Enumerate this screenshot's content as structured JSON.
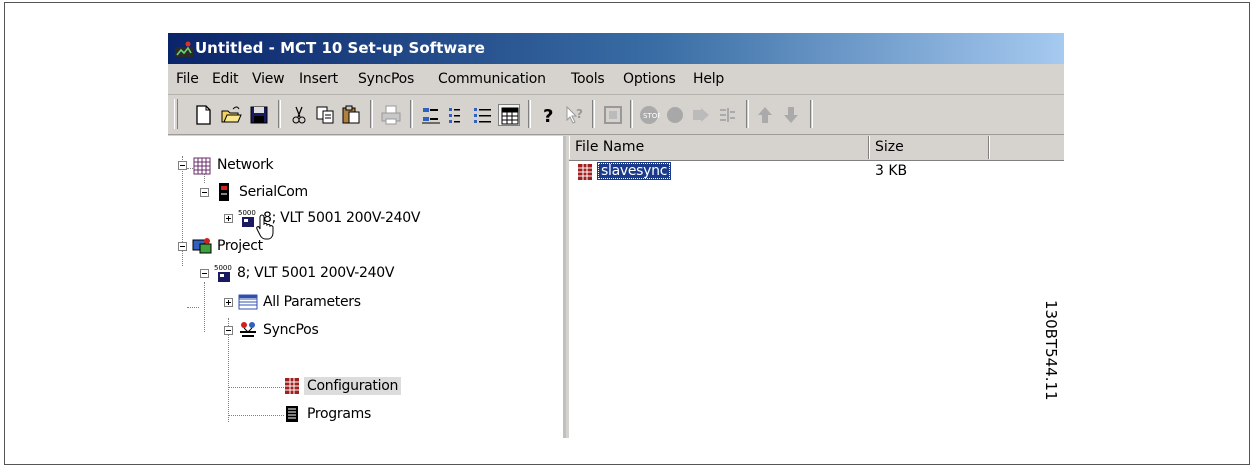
{
  "window": {
    "title": "Untitled - MCT 10 Set-up Software"
  },
  "menu": [
    "File",
    "Edit",
    "View",
    "Insert",
    "SyncPos",
    "Communication",
    "Tools",
    "Options",
    "Help"
  ],
  "toolbar": {
    "buttons": [
      "new-icon",
      "open-icon",
      "save-icon",
      "cut-icon",
      "copy-icon",
      "paste-icon",
      "print-icon",
      "small-icons-icon",
      "list-icon",
      "details-icon",
      "grid-icon",
      "help-icon",
      "whats-this-icon",
      "network-scan-icon",
      "stop-icon",
      "record-icon",
      "forward-icon",
      "sync-icon",
      "up-arrow-icon",
      "down-arrow-icon"
    ]
  },
  "tree": {
    "network": "Network",
    "serialcom": "SerialCom",
    "device_serial": "8; VLT 5001 200V-240V",
    "project": "Project",
    "device_project": "8; VLT 5001 200V-240V",
    "all_parameters": "All Parameters",
    "syncpos": "SyncPos",
    "configuration": "Configuration",
    "programs": "Programs"
  },
  "file_list": {
    "columns": [
      "File Name",
      "Size"
    ],
    "rows": [
      {
        "name": "slavesync",
        "size": "3 KB"
      }
    ]
  },
  "figure_code": "130BT544.11"
}
